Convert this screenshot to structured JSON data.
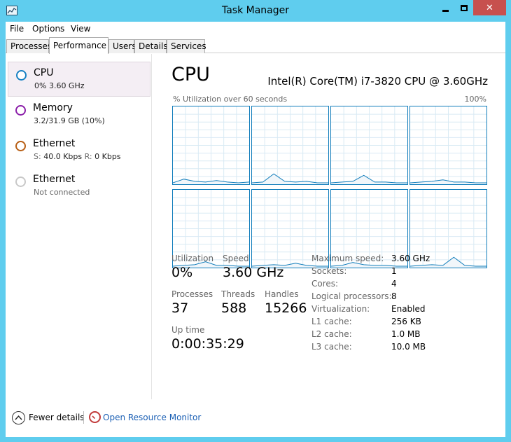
{
  "window": {
    "title": "Task Manager",
    "controls": {
      "minimize": "minimize",
      "maximize": "maximize",
      "close": "close"
    }
  },
  "menu": [
    "File",
    "Options",
    "View"
  ],
  "tabs": [
    "Processes",
    "Performance",
    "Users",
    "Details",
    "Services"
  ],
  "active_tab": "Performance",
  "sidebar": {
    "items": [
      {
        "title": "CPU",
        "sub": "0% 3.60 GHz",
        "color": "#1982c4",
        "selected": true
      },
      {
        "title": "Memory",
        "sub": "3.2/31.9 GB (10%)",
        "color": "#8b1fa9",
        "selected": false
      },
      {
        "title": "Ethernet",
        "sub_s_label": "S:",
        "sub_s_value": "40.0 Kbps",
        "sub_r_label": "R:",
        "sub_r_value": "0 Kbps",
        "color": "#b75e14",
        "selected": false
      },
      {
        "title": "Ethernet",
        "sub": "Not connected",
        "color": "#bbbbbb",
        "selected": false
      }
    ]
  },
  "main": {
    "heading": "CPU",
    "cpu_name": "Intel(R) Core(TM) i7-3820 CPU @ 3.60GHz",
    "util_label": "% Utilization over 60 seconds",
    "util_max": "100%",
    "graph_color": "#117dbb",
    "graph_grid_color": "#d9eaf4",
    "graph_fill": "#f1f6fa",
    "graphs": [
      [
        0,
        0.05,
        0.02,
        0.01,
        0.03,
        0.01,
        0,
        0.01
      ],
      [
        0,
        0.01,
        0.12,
        0.02,
        0.01,
        0.02,
        0,
        0
      ],
      [
        0,
        0.01,
        0.02,
        0.1,
        0.01,
        0.01,
        0,
        0
      ],
      [
        0,
        0.01,
        0.02,
        0.04,
        0.01,
        0.01,
        0,
        0
      ],
      [
        0,
        0.01,
        0.02,
        0.06,
        0.01,
        0.01,
        0,
        0
      ],
      [
        0,
        0.01,
        0.02,
        0.01,
        0.04,
        0.01,
        0,
        0
      ],
      [
        0,
        0.01,
        0.05,
        0.02,
        0.01,
        0.01,
        0,
        0
      ],
      [
        0,
        0.01,
        0.02,
        0.01,
        0.12,
        0.01,
        0,
        0
      ]
    ],
    "stats": {
      "utilization_label": "Utilization",
      "utilization_value": "0%",
      "speed_label": "Speed",
      "speed_value": "3.60 GHz",
      "processes_label": "Processes",
      "processes_value": "37",
      "threads_label": "Threads",
      "threads_value": "588",
      "handles_label": "Handles",
      "handles_value": "15266",
      "uptime_label": "Up time",
      "uptime_value": "0:00:35:29"
    },
    "specs": [
      {
        "label": "Maximum speed:",
        "value": "3.60 GHz"
      },
      {
        "label": "Sockets:",
        "value": "1"
      },
      {
        "label": "Cores:",
        "value": "4"
      },
      {
        "label": "Logical processors:",
        "value": "8"
      },
      {
        "label": "Virtualization:",
        "value": "Enabled"
      },
      {
        "label": "L1 cache:",
        "value": "256 KB"
      },
      {
        "label": "L2 cache:",
        "value": "1.0 MB"
      },
      {
        "label": "L3 cache:",
        "value": "10.0 MB"
      }
    ]
  },
  "footer": {
    "fewer_details": "Fewer details",
    "open_resource_monitor": "Open Resource Monitor"
  }
}
